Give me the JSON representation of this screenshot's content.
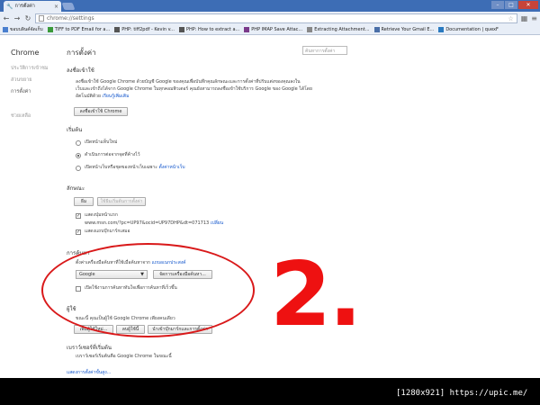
{
  "browser": {
    "tab_title": "การตั้งค่า",
    "tab_close": "×",
    "address": "chrome://settings",
    "bookmarks": [
      {
        "label": "ขอบบลินค์จัดเก็บ",
        "color": "#4a7fcf"
      },
      {
        "label": "TIFF to PDF Email for a...",
        "color": "#3a9a3a"
      },
      {
        "label": "PHP: tiff2pdf - Kevin v...",
        "color": "#555555"
      },
      {
        "label": "PHP: How to extract a...",
        "color": "#555555"
      },
      {
        "label": "PHP IMAP Save Attac...",
        "color": "#7a3a8a"
      },
      {
        "label": "Extracting Attachment...",
        "color": "#888888"
      },
      {
        "label": "Retrieve Your Gmail E...",
        "color": "#4a6fa8"
      },
      {
        "label": "Documentation | quexF",
        "color": "#2a7ac0"
      }
    ]
  },
  "sidebar": {
    "brand": "Chrome",
    "items": [
      "ประวัติการเข้าชม",
      "ส่วนขยาย",
      "การตั้งค่า",
      "ช่วยเหลือ"
    ]
  },
  "settings": {
    "title": "การตั้งค่า",
    "search_placeholder": "ค้นหาการตั้งค่า",
    "signin": {
      "title": "ลงชื่อเข้าใช้",
      "desc1": "ลงชื่อเข้าใช้ Google Chrome ด้วยบัญชี Google ของคุณเพื่อบันทึกคุณลักษณะและการตั้งค่าที่ปรับแต่งของคุณลงใน",
      "desc2": "เว็บและเข้าถึงได้จาก Google Chrome ในทุกคอมพิวเตอร์ คุณยังสามารถลงชื่อเข้าใช้บริการ Google ของ Google ได้โดย",
      "desc3": "อัตโนมัติด้วย",
      "learn_more": "เรียนรู้เพิ่มเติม",
      "button": "ลงชื่อเข้าใช้ Chrome"
    },
    "startup": {
      "title": "เริ่มต้น",
      "options": [
        "เปิดหน้าแท็บใหม่",
        "ดำเนินการต่อจากจุดที่ค้างไว้",
        "เปิดหน้าเว็บหรือชุดของหน้าเว็บเฉพาะ"
      ],
      "set_pages": "ตั้งค่าหน้าเว็บ"
    },
    "appearance": {
      "title": "ลักษณะ",
      "theme_button": "ธีม",
      "reset_button": "ใช้ธีมเริ่มต้นการตั้งค่า",
      "show_home": "แสดงปุ่มหน้าแรก",
      "home_url": "www.msn.com/?pc=UP97&ocid=UP97DHP&dt=071713",
      "change": "เปลี่ยน",
      "show_bookmarks": "แสดงแถบบุ๊กมาร์กเสมอ"
    },
    "search": {
      "title": "การค้นหา",
      "desc": "ตั้งค่าเครื่องมือค้นหาที่ใช้เมื่อค้นหาจาก",
      "omnibox_link": "แถบอเนกประสงค์",
      "engine": "Google",
      "manage_button": "จัดการเครื่องมือค้นหา...",
      "instant": "เปิดใช้งานการค้นหาทันใจเพื่อการค้นหาที่เร็วขึ้น"
    },
    "users": {
      "title": "ผู้ใช้",
      "desc": "ขณะนี้ คุณเป็นผู้ใช้ Google Chrome เพียงคนเดียว",
      "add": "เพิ่มผู้ใช้ใหม่...",
      "delete": "ลบผู้ใช้นี้",
      "import": "นำเข้าบุ๊กมาร์กและการตั้งค่า"
    },
    "default_browser": {
      "title": "เบราว์เซอร์ที่เริ่มต้น",
      "desc": "เบราว์เซอร์เริ่มต้นคือ Google Chrome ในขณะนี้"
    },
    "advanced": "แสดงการตั้งค่าขั้นสูง..."
  },
  "annotation": {
    "number": "2.",
    "color": "#ee1111"
  },
  "watermark": "[1280x921] https://upic.me/"
}
